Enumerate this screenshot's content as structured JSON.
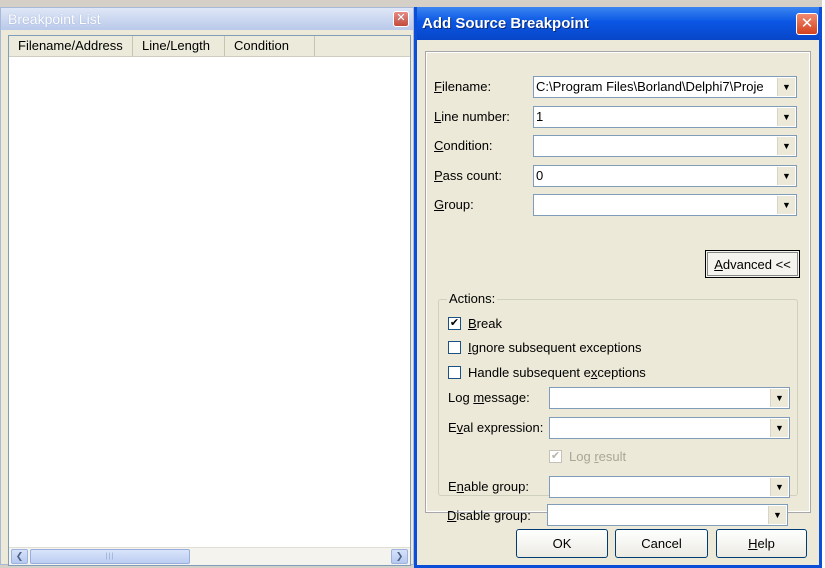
{
  "breakpoint_list": {
    "title": "Breakpoint List",
    "close_glyph": "✕",
    "columns": [
      "Filename/Address",
      "Line/Length",
      "Condition"
    ],
    "hscroll": {
      "left_arrow": "❮",
      "right_arrow": "❯",
      "thumb_grip": "|||"
    }
  },
  "dialog": {
    "title": "Add Source Breakpoint",
    "close_glyph": "✕",
    "fields": {
      "filename": {
        "label_pre": "",
        "label_key": "F",
        "label_post": "ilename:",
        "value": "C:\\Program Files\\Borland\\Delphi7\\Proje"
      },
      "line_number": {
        "label_pre": "",
        "label_key": "L",
        "label_post": "ine number:",
        "value": "1"
      },
      "condition": {
        "label_pre": "",
        "label_key": "C",
        "label_post": "ondition:",
        "value": ""
      },
      "pass_count": {
        "label_pre": "",
        "label_key": "P",
        "label_post": "ass count:",
        "value": "0"
      },
      "group": {
        "label_pre": "",
        "label_key": "G",
        "label_post": "roup:",
        "value": ""
      }
    },
    "advanced_button": {
      "label_key": "A",
      "label_post": "dvanced <<"
    },
    "actions": {
      "legend": "Actions:",
      "break": {
        "checked": "✔",
        "label_key": "B",
        "label_post": "reak"
      },
      "ignore": {
        "checked": "",
        "label_key": "I",
        "label_post": "gnore subsequent exceptions"
      },
      "handle": {
        "checked": "",
        "label_pre": "Handle subsequent e",
        "label_key": "x",
        "label_post": "ceptions"
      },
      "log_message": {
        "label_pre": "Log ",
        "label_key": "m",
        "label_post": "essage:",
        "value": ""
      },
      "eval_expression": {
        "label_pre": "E",
        "label_key": "v",
        "label_post": "al expression:",
        "value": ""
      },
      "log_result": {
        "checked": "✔",
        "label_pre": "Log ",
        "label_key": "r",
        "label_post": "esult"
      },
      "enable_group": {
        "label_pre": "E",
        "label_key": "n",
        "label_post": "able group:",
        "value": ""
      },
      "disable_group": {
        "label_pre": "",
        "label_key": "D",
        "label_post": "isable group:",
        "value": ""
      }
    },
    "buttons": {
      "ok": "OK",
      "cancel": "Cancel",
      "help_key": "H",
      "help_post": "elp"
    },
    "dropdown_glyph": "▼"
  }
}
